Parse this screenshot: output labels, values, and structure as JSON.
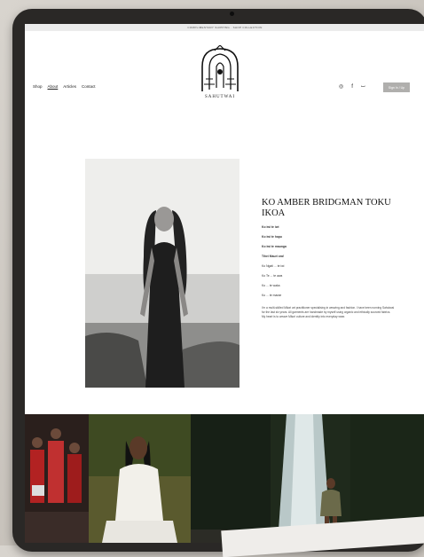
{
  "banner": {
    "text": "COMPLIMENTARY SHIPPING · SHOP COLLECTION"
  },
  "nav": {
    "links": [
      "Shop",
      "About",
      "Articles",
      "Contact"
    ],
    "signin": "Sign In / Up",
    "icons": [
      "instagram-icon",
      "facebook-icon",
      "cart-icon"
    ]
  },
  "logo": {
    "name": "SAHUTWAI"
  },
  "bio": {
    "title": "KO AMBER BRIDGMAN TOKU IKOA",
    "lines": [
      "Ko iwi te iwi",
      "Ko iwi te hapu",
      "Ko iwi te maunga",
      "Tihei Mauri ora!",
      "Ko Ngati ... te iwi",
      "Ko Te ... te awa",
      "Ko ... te waka",
      "Ko ... te marae"
    ],
    "paragraph": "I'm a multi-skilled Māori art practitioner specialising in weaving and fashion. I have been running Sahutwai for the last six years. All garments are handmade by myself using organic and ethically sourced fabrics. My heart is to weave Māori culture and identity into everyday wear."
  }
}
